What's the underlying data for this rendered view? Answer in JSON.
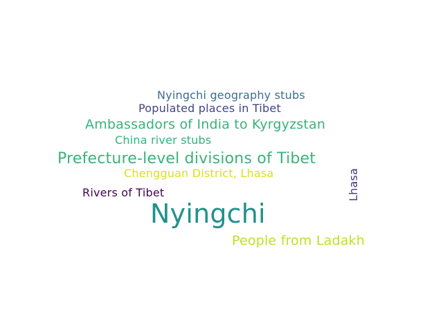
{
  "words": [
    {
      "text": "Nyingchi geography stubs",
      "color": "#3b6e8f"
    },
    {
      "text": "Populated places in Tibet",
      "color": "#414487"
    },
    {
      "text": "Ambassadors of India to Kyrgyzstan",
      "color": "#38b27a"
    },
    {
      "text": "China river stubs",
      "color": "#2fb47c"
    },
    {
      "text": "Prefecture-level divisions of Tibet",
      "color": "#3ab37a"
    },
    {
      "text": "Chengguan District, Lhasa",
      "color": "#d8e219"
    },
    {
      "text": "Lhasa",
      "color": "#46327e"
    },
    {
      "text": "Rivers of Tibet",
      "color": "#440154"
    },
    {
      "text": "Nyingchi",
      "color": "#21918c"
    },
    {
      "text": "People from Ladakh",
      "color": "#c2df23"
    }
  ]
}
